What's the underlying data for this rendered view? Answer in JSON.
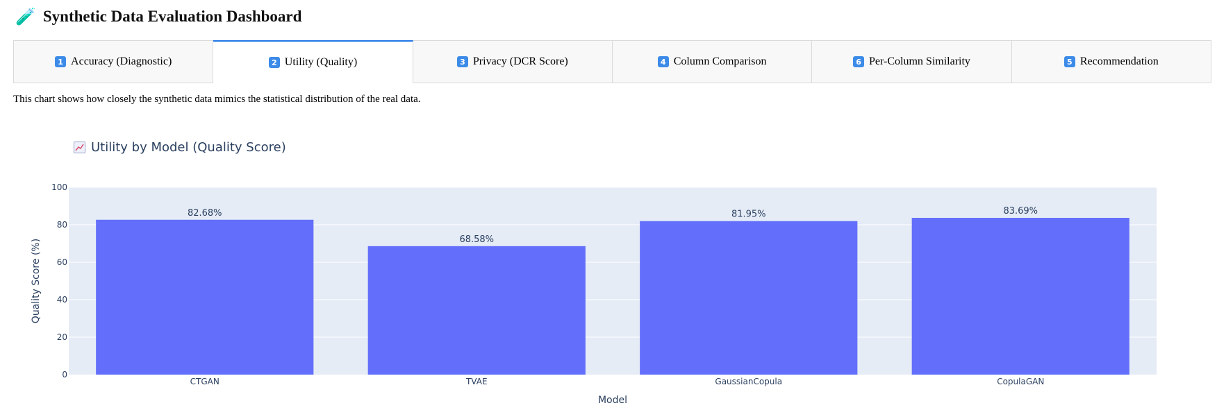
{
  "header": {
    "icon": "test-tube-icon",
    "title": "Synthetic Data Evaluation Dashboard"
  },
  "tabs": [
    {
      "num": "1",
      "label": "Accuracy (Diagnostic)",
      "active": false
    },
    {
      "num": "2",
      "label": "Utility (Quality)",
      "active": true
    },
    {
      "num": "3",
      "label": "Privacy (DCR Score)",
      "active": false
    },
    {
      "num": "4",
      "label": "Column Comparison",
      "active": false
    },
    {
      "num": "6",
      "label": "Per-Column Similarity",
      "active": false
    },
    {
      "num": "5",
      "label": "Recommendation",
      "active": false
    }
  ],
  "description": "This chart shows how closely the synthetic data mimics the statistical distribution of the real data.",
  "colors": {
    "bar": "#636efa",
    "plot_bg": "#e5ecf6",
    "accent": "#1f77e5"
  },
  "chart_data": {
    "type": "bar",
    "title": "Utility by Model (Quality Score)",
    "title_icon": "chart-increasing-icon",
    "categories": [
      "CTGAN",
      "TVAE",
      "GaussianCopula",
      "CopulaGAN"
    ],
    "values": [
      82.68,
      68.58,
      81.95,
      83.69
    ],
    "data_labels": [
      "82.68%",
      "68.58%",
      "81.95%",
      "83.69%"
    ],
    "xlabel": "Model",
    "ylabel": "Quality Score (%)",
    "ylim": [
      0,
      100
    ],
    "yticks": [
      0,
      20,
      40,
      60,
      80,
      100
    ],
    "grid": true
  }
}
